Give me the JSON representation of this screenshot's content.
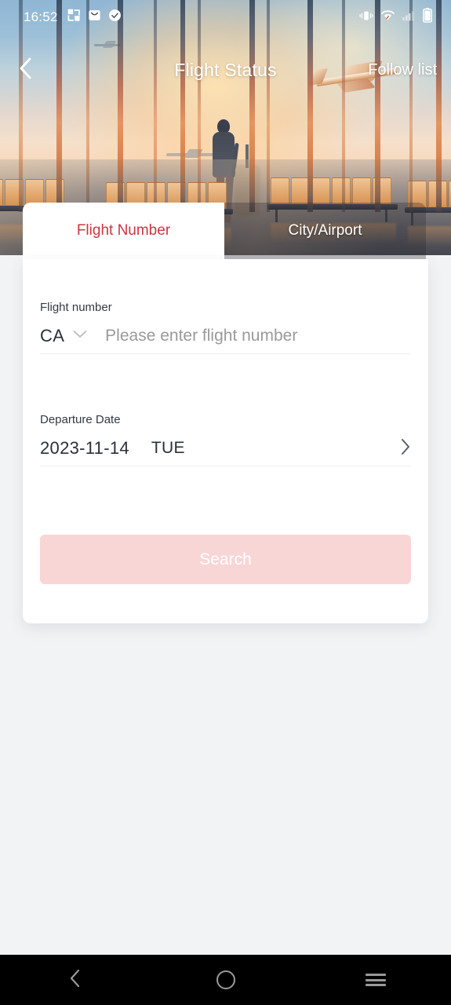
{
  "status_bar": {
    "time": "16:52",
    "left_icons": [
      "screenshot-share-icon",
      "mail-icon",
      "check-circle-icon"
    ],
    "right_icons": [
      "vibrate-icon",
      "wifi-icon",
      "signal-bars-icon",
      "battery-icon"
    ]
  },
  "header": {
    "back_icon": "chevron-left-icon",
    "title": "Flight Status",
    "action_label": "Follow list"
  },
  "tabs": [
    {
      "label": "Flight Number",
      "active": true
    },
    {
      "label": "City/Airport",
      "active": false
    }
  ],
  "form": {
    "flight_number": {
      "label": "Flight number",
      "airline_code": "CA",
      "dropdown_icon": "chevron-down-icon",
      "placeholder": "Please enter flight number",
      "value": ""
    },
    "departure_date": {
      "label": "Departure Date",
      "date": "2023-11-14",
      "weekday": "TUE",
      "chevron_icon": "chevron-right-icon"
    },
    "search_button": {
      "label": "Search",
      "enabled": false
    }
  },
  "android_nav": {
    "back_icon": "chevron-left-icon",
    "home_icon": "circle-home-icon",
    "recents_icon": "hamburger-recents-icon"
  },
  "colors": {
    "accent_red": "#cf3440",
    "button_disabled_bg": "#f9d6d6",
    "page_background": "#f2f3f5",
    "card_background": "#ffffff",
    "text_primary": "#2b3038",
    "text_placeholder": "#9a9a9a",
    "divider": "#efefef"
  },
  "hero": {
    "description": "airport-terminal-sunset-photo"
  }
}
